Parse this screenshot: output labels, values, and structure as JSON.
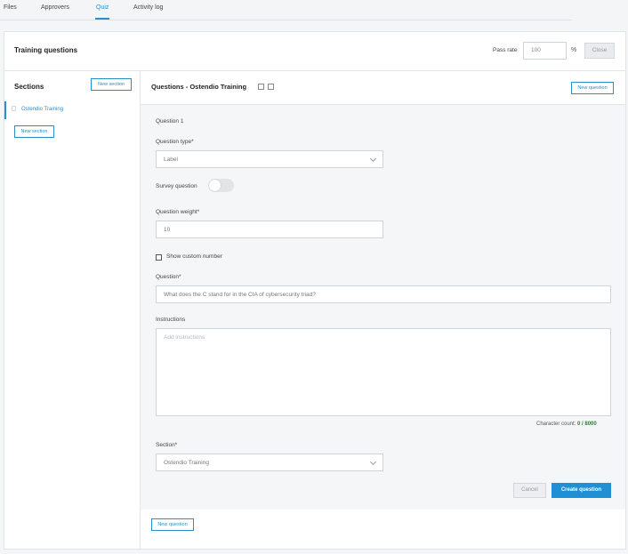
{
  "tabs": [
    {
      "label": "Files"
    },
    {
      "label": "Approvers"
    },
    {
      "label": "Quiz"
    },
    {
      "label": "Activity log"
    }
  ],
  "card": {
    "title": "Training questions",
    "pass_rate_label": "Pass rate",
    "pass_rate_value": "100",
    "percent_symbol": "%",
    "close_label": "Close"
  },
  "sections": {
    "title": "Sections",
    "new_section_label": "New section",
    "items": [
      {
        "label": "Ostendio Training"
      }
    ]
  },
  "main": {
    "title": "Questions - Ostendio Training",
    "new_question_label": "New question"
  },
  "form": {
    "question_number": "Question 1",
    "question_type_label": "Question type*",
    "question_type_value": "Label",
    "survey_question_label": "Survey question",
    "survey_question_on": false,
    "question_weight_label": "Question weight*",
    "question_weight_value": "10",
    "show_custom_number_label": "Show custom number",
    "show_custom_number_checked": false,
    "question_label": "Question*",
    "question_value": "What does the C stand for in the CIA of cybersecurity triad?",
    "instructions_label": "Instructions",
    "instructions_placeholder": "Add instructions",
    "char_count_label": "Character count:",
    "char_count_value": "0 / 8000",
    "section_label": "Section*",
    "section_value": "Ostendio Training",
    "cancel_label": "Cancel",
    "create_label": "Create question"
  },
  "colors": {
    "accent": "#2a8ec9",
    "primary_button": "#1f8fd6",
    "char_count": "#2e7d32"
  }
}
